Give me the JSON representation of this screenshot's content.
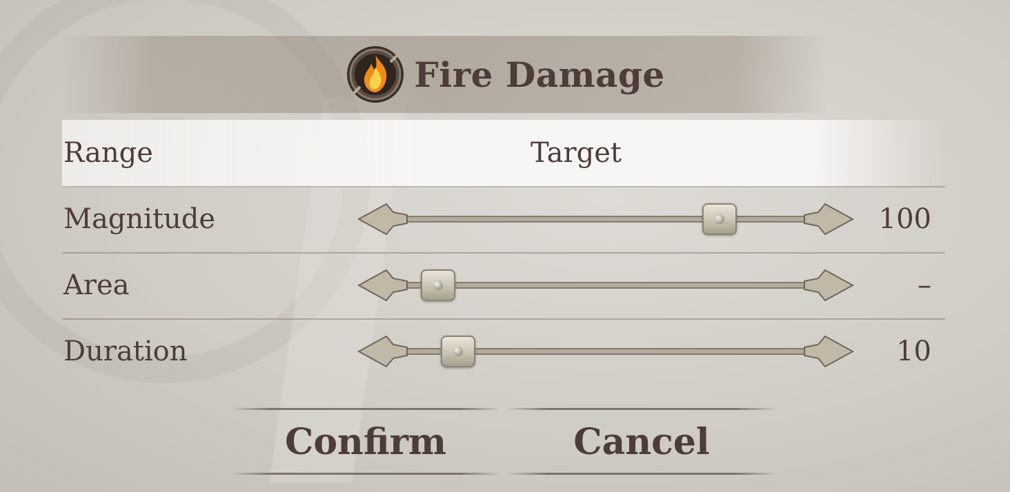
{
  "dialog": {
    "title": "Fire Damage",
    "icon": "fire-emblem-icon"
  },
  "rows": [
    {
      "label": "Range",
      "value": "Target",
      "kind": "selector"
    },
    {
      "label": "Magnitude",
      "value": "100",
      "kind": "slider",
      "level": 0.84
    },
    {
      "label": "Area",
      "value": "–",
      "kind": "slider",
      "level": 0.0
    },
    {
      "label": "Duration",
      "value": "10",
      "kind": "slider",
      "level": 0.06
    }
  ],
  "buttons": {
    "confirm": "Confirm",
    "cancel": "Cancel"
  },
  "colors": {
    "text": "#4e3c39",
    "flame": "#f08a1a"
  }
}
